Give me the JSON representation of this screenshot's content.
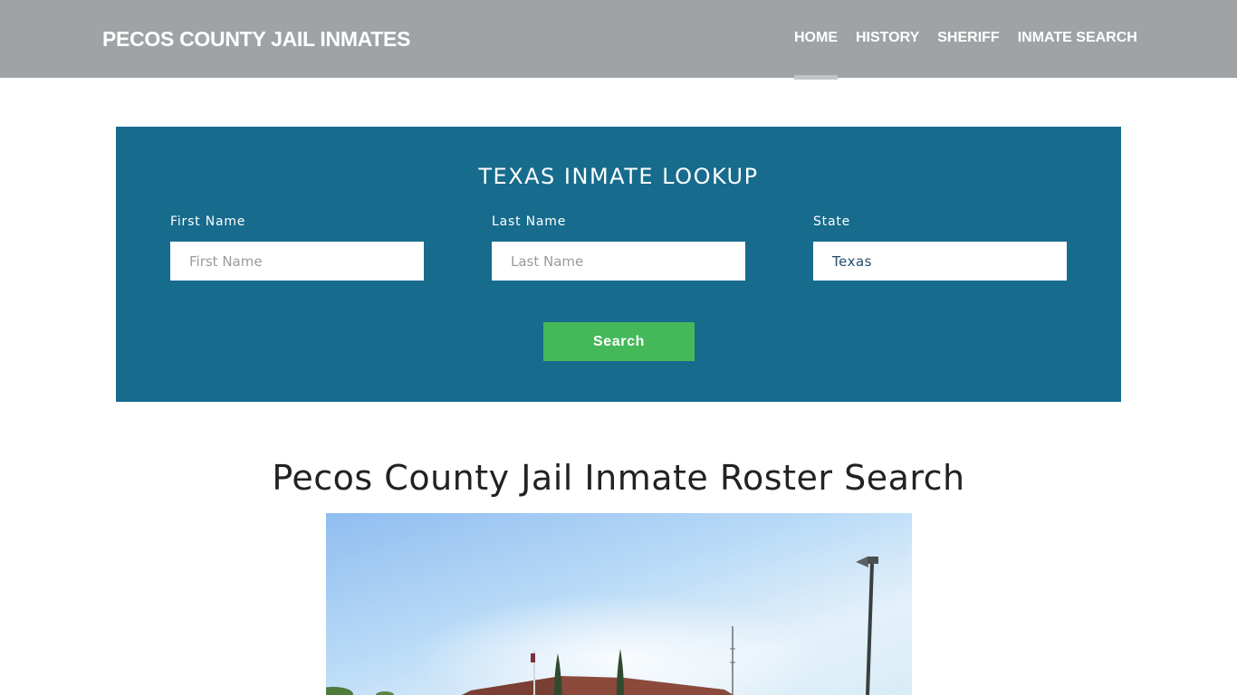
{
  "header": {
    "brand": "PECOS COUNTY JAIL INMATES",
    "nav": [
      {
        "label": "HOME",
        "active": true
      },
      {
        "label": "HISTORY",
        "active": false
      },
      {
        "label": "SHERIFF",
        "active": false
      },
      {
        "label": "INMATE SEARCH",
        "active": false
      }
    ]
  },
  "lookup": {
    "title": "TEXAS INMATE LOOKUP",
    "first_name": {
      "label": "First Name",
      "placeholder": "First Name",
      "value": ""
    },
    "last_name": {
      "label": "Last Name",
      "placeholder": "Last Name",
      "value": ""
    },
    "state": {
      "label": "State",
      "selected": "Texas"
    },
    "search_label": "Search"
  },
  "main": {
    "title": "Pecos County Jail Inmate Roster Search",
    "photo_alt": "Pecos County Jail building exterior"
  },
  "colors": {
    "header_bg": "#9fa3a6",
    "lookup_bg": "#176b8d",
    "search_button": "#45b85a"
  }
}
